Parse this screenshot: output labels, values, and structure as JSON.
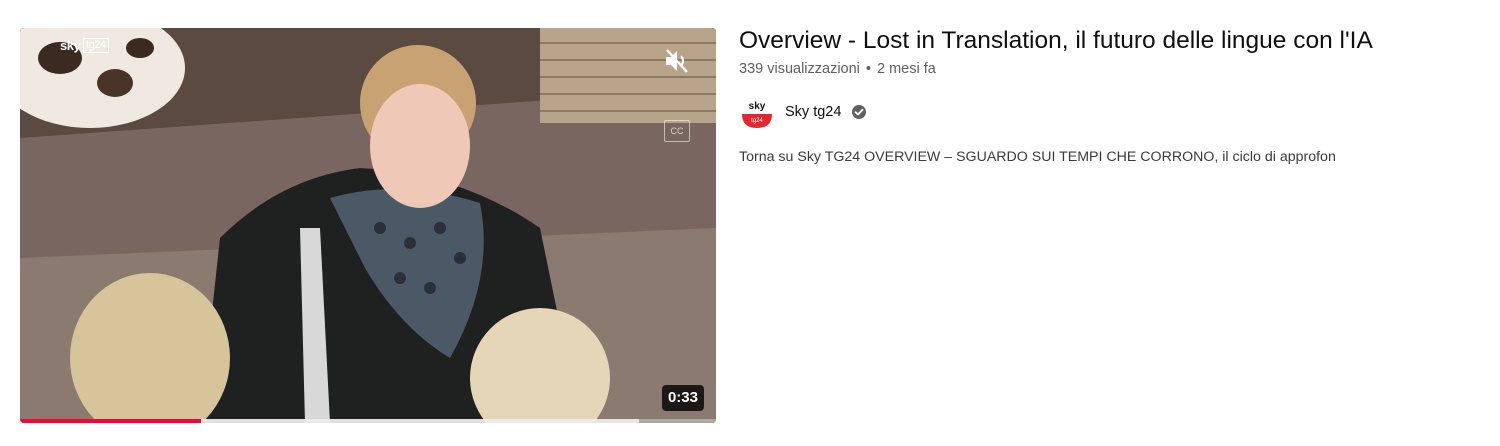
{
  "video": {
    "title": "Overview - Lost in Translation, il futuro delle lingue con l'IA",
    "views": "339 visualizzazioni",
    "separator": "•",
    "age": "2 mesi fa",
    "duration": "0:33",
    "progress_fraction": 0.26,
    "buffer_fraction": 0.89,
    "channel": {
      "name": "Sky tg24",
      "avatar_text": "sky tg24",
      "verified_icon": "verified-check-icon"
    },
    "description": "Torna su Sky TG24 OVERVIEW – SGUARDO SUI TEMPI CHE CORRONO, il ciclo di approfon",
    "thumbnail": {
      "watermark_left": "sky",
      "watermark_right": "tg24",
      "cc_label": "CC",
      "mute_icon": "volume-muted-icon"
    }
  },
  "colors": {
    "progress": "#ff0033",
    "avatar_red": "#e3262f"
  }
}
